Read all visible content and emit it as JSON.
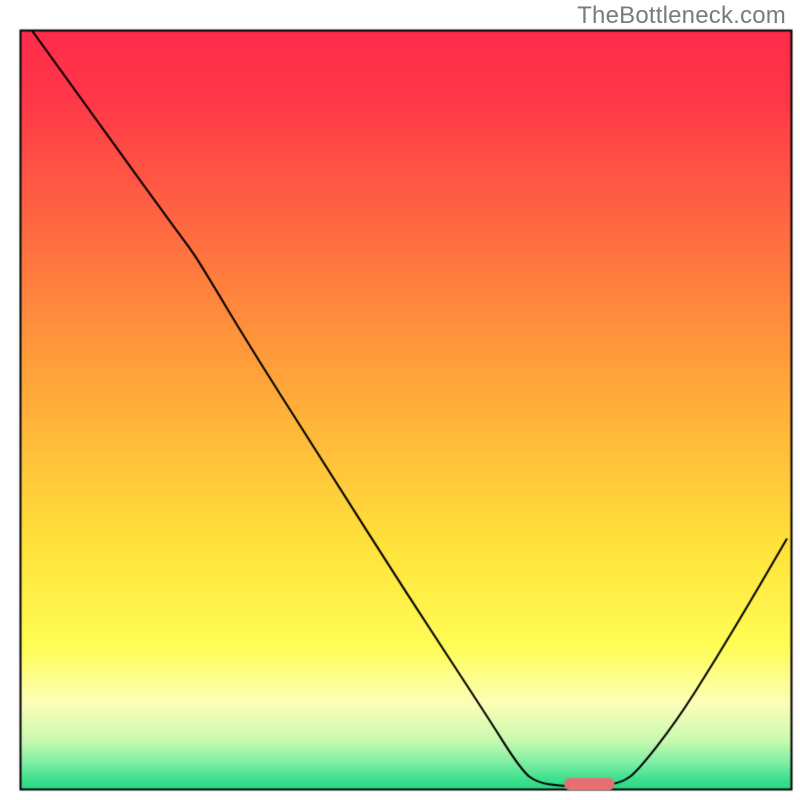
{
  "watermark": "TheBottleneck.com",
  "chart_data": {
    "type": "line",
    "title": "",
    "xlabel": "",
    "ylabel": "",
    "xlim": [
      0,
      100
    ],
    "ylim": [
      0,
      100
    ],
    "grid": false,
    "background_gradient": {
      "stops": [
        {
          "pos": 0.0,
          "color": "#ff2c4b"
        },
        {
          "pos": 0.09,
          "color": "#ff3748"
        },
        {
          "pos": 0.45,
          "color": "#ffa23a"
        },
        {
          "pos": 0.68,
          "color": "#ffe33b"
        },
        {
          "pos": 0.81,
          "color": "#fffd55"
        },
        {
          "pos": 0.885,
          "color": "#fdffb8"
        },
        {
          "pos": 0.935,
          "color": "#c9f9b0"
        },
        {
          "pos": 0.965,
          "color": "#7ceea3"
        },
        {
          "pos": 0.985,
          "color": "#3fe08f"
        },
        {
          "pos": 1.0,
          "color": "#2bd885"
        }
      ]
    },
    "series": [
      {
        "name": "bottleneck-curve",
        "color": "#000000",
        "width": 2,
        "points": [
          {
            "x": 1.5,
            "y": 100.0
          },
          {
            "x": 10.0,
            "y": 88.0
          },
          {
            "x": 20.0,
            "y": 74.0
          },
          {
            "x": 22.0,
            "y": 71.3
          },
          {
            "x": 23.5,
            "y": 69.0
          },
          {
            "x": 30.0,
            "y": 58.0
          },
          {
            "x": 40.0,
            "y": 42.0
          },
          {
            "x": 50.0,
            "y": 26.0
          },
          {
            "x": 60.0,
            "y": 10.5
          },
          {
            "x": 65.0,
            "y": 2.5
          },
          {
            "x": 67.0,
            "y": 1.0
          },
          {
            "x": 70.0,
            "y": 0.5
          },
          {
            "x": 75.0,
            "y": 0.5
          },
          {
            "x": 78.0,
            "y": 1.0
          },
          {
            "x": 80.0,
            "y": 2.5
          },
          {
            "x": 85.0,
            "y": 9.0
          },
          {
            "x": 90.0,
            "y": 17.0
          },
          {
            "x": 95.0,
            "y": 25.5
          },
          {
            "x": 99.3,
            "y": 33.0
          }
        ]
      }
    ],
    "marker": {
      "name": "optimal-range",
      "color": "#e76f74",
      "x_start": 70.5,
      "x_end": 77.0,
      "y": 0.8,
      "thickness_px": 12
    },
    "border": {
      "color": "#000000",
      "width": 2
    }
  }
}
